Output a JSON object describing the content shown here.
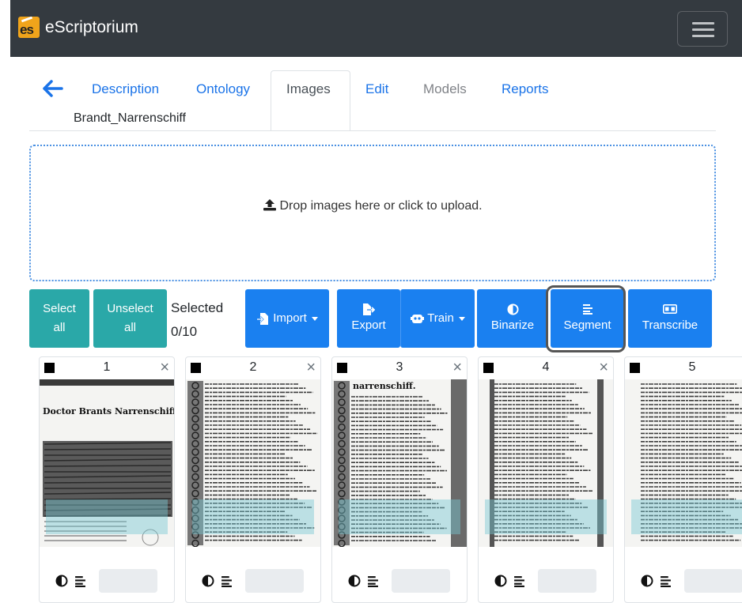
{
  "navbar": {
    "brand": "eScriptorium",
    "logo_text": "es"
  },
  "tabs": [
    {
      "label": "Description",
      "state": "link"
    },
    {
      "label": "Ontology",
      "state": "link"
    },
    {
      "label": "Images",
      "state": "active"
    },
    {
      "label": "Edit",
      "state": "link"
    },
    {
      "label": "Models",
      "state": "disabled"
    },
    {
      "label": "Reports",
      "state": "link"
    }
  ],
  "document": {
    "name": "Brandt_Narrenschiff"
  },
  "dropzone": {
    "message": "Drop images here or click to upload."
  },
  "toolbar": {
    "select_all": "Select all",
    "unselect_all": "Unselect all",
    "selected_label": "Selected",
    "selected_count": "0/10",
    "import": "Import",
    "export": "Export",
    "train": "Train",
    "binarize": "Binarize",
    "segment": "Segment",
    "transcribe": "Transcribe"
  },
  "cards": [
    {
      "number": "1",
      "heading": "Doctor Brants Narrenschiff",
      "close": "×"
    },
    {
      "number": "2",
      "heading": "",
      "close": "×"
    },
    {
      "number": "3",
      "heading": "narrenschiff.",
      "close": "×"
    },
    {
      "number": "4",
      "heading": "",
      "close": "×"
    },
    {
      "number": "5",
      "heading": "",
      "close": ""
    }
  ],
  "colors": {
    "navbar": "#343a40",
    "accent_blue": "#1a80f0",
    "accent_teal": "#2aa8a8",
    "link": "#1a73e8"
  }
}
